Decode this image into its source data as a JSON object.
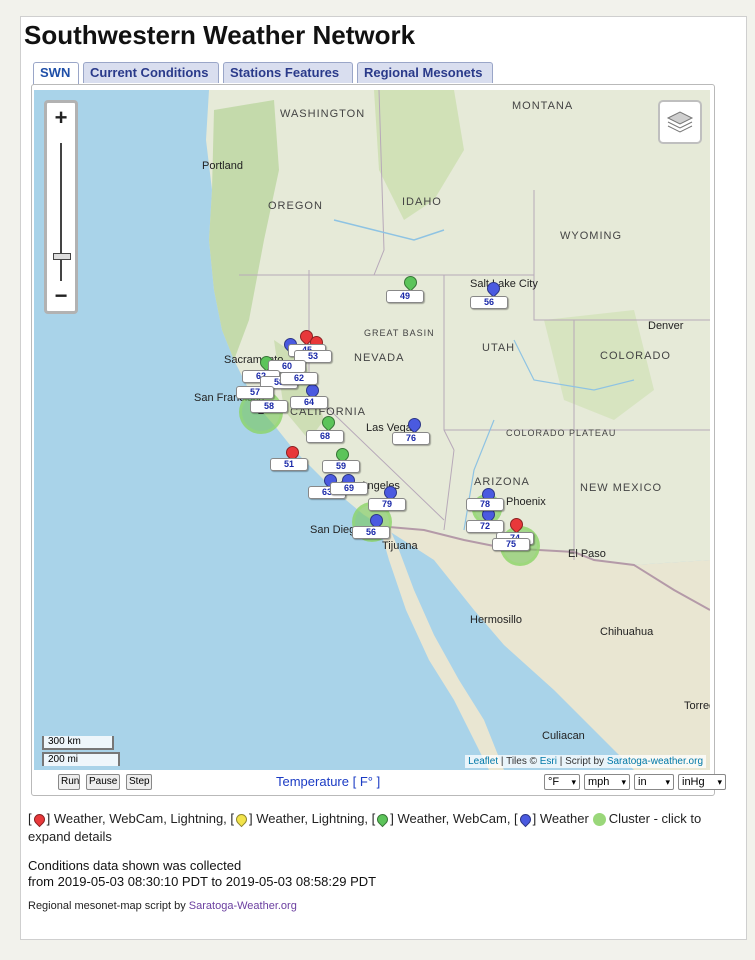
{
  "title": "Southwestern Weather Network",
  "tabs": [
    "SWN",
    "Current Conditions",
    "Stations Features",
    "Regional Mesonets"
  ],
  "map": {
    "state_labels": [
      "WASHINGTON",
      "MONTANA",
      "IDAHO",
      "OREGON",
      "WYOMING",
      "NEVADA",
      "UTAH",
      "COLORADO",
      "ARIZONA",
      "NEW MEXICO",
      "COLORADO PLATEAU",
      "GREAT BASIN",
      "CALIFORNIA"
    ],
    "cities": [
      "Portland",
      "Salt Lake City",
      "Denver",
      "Sacramento",
      "San Francisco",
      "Las Vegas",
      "Los Angeles",
      "San Diego",
      "Tijuana",
      "Phoenix",
      "El Paso",
      "Hermosillo",
      "Chihuahua",
      "Culiacan",
      "Torreon"
    ],
    "station_values": [
      "49",
      "56",
      "45",
      "53",
      "60",
      "62",
      "58",
      "62",
      "57",
      "58",
      "64",
      "68",
      "76",
      "51",
      "59",
      "63",
      "69",
      "79",
      "56",
      "78",
      "72",
      "74",
      "75"
    ],
    "cluster_label": "2",
    "zoom_in": "+",
    "zoom_out": "−",
    "scale_km": "300 km",
    "scale_mi": "200 mi",
    "attribution": {
      "leaflet": "Leaflet",
      "tiles": " | Tiles © ",
      "esri": "Esri",
      "script": " | Script by ",
      "saratoga": "Saratoga-weather.org"
    }
  },
  "controls": {
    "run": "Run",
    "pause": "Pause",
    "step": "Step",
    "label": "Temperature [ F° ]",
    "temp_unit": "°F",
    "wind_unit": "mph",
    "rain_unit": "in",
    "baro_unit": "inHg"
  },
  "legend": {
    "red": "] Weather, WebCam, Lightning, [",
    "yellow": "] Weather, Lightning, [",
    "green": "] Weather, WebCam, [",
    "blue": "] Weather",
    "cluster": "Cluster - click to expand details",
    "open": "["
  },
  "conditions": {
    "line1": "Conditions data shown was collected",
    "line2": "from 2019-05-03 08:30:10 PDT to 2019-05-03 08:58:29 PDT"
  },
  "credit": {
    "prefix": "Regional mesonet-map script by ",
    "link": "Saratoga-Weather.org"
  },
  "colors": {
    "red": "#e8383a",
    "yellow": "#f2e34b",
    "green": "#5cc45a",
    "blue": "#4a5ae0",
    "water": "#a9d3e9",
    "land": "#e6ead8"
  }
}
